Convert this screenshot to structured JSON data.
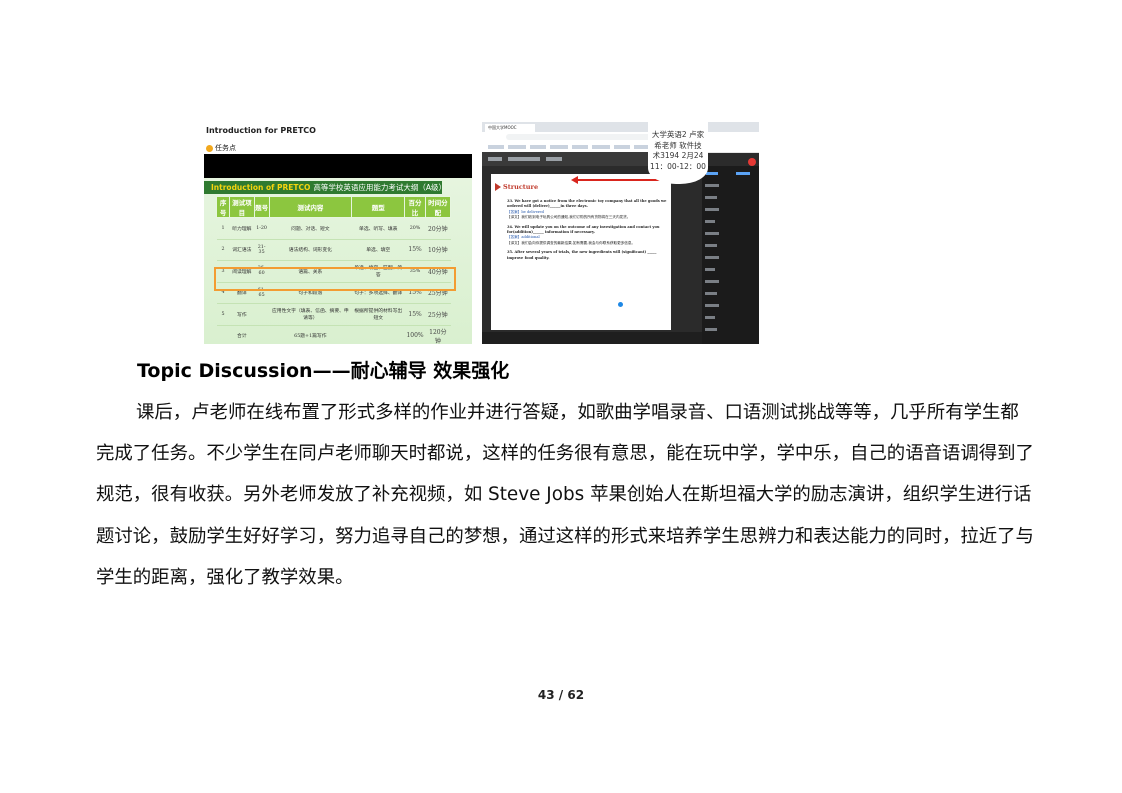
{
  "left_screenshot": {
    "title": "Introduction for PRETCO",
    "task_label": "任务点",
    "banner_highlight": "Introduction of PRETCO",
    "banner_text": "高等学校英语应用能力考试大纲（A级）",
    "table": {
      "headers": [
        "序号",
        "测试项目",
        "题号",
        "测试内容",
        "题型",
        "百分比",
        "时间分配"
      ],
      "rows": [
        [
          "1",
          "听力理解",
          "1-20",
          "问题、对话、短文",
          "单选、听写、填表",
          "20%",
          "20分钟"
        ],
        [
          "2",
          "词汇语法",
          "21-35",
          "语法结构、词形变化",
          "单选、填空",
          "15%",
          "10分钟"
        ],
        [
          "3",
          "阅读理解",
          "36-60",
          "语篇、关系",
          "单选、填空、匹配、简答",
          "35%",
          "40分钟"
        ],
        [
          "4",
          "翻译",
          "61-65",
          "句子和段落",
          "句子：多项选择、翻译",
          "15%",
          "25分钟"
        ],
        [
          "5",
          "写作",
          "",
          "应用性文字（填表、信函、摘要、申请等）",
          "根据所提供的材料写出短文",
          "15%",
          "25分钟"
        ],
        [
          "",
          "合计",
          "",
          "65题+1篇写作",
          "",
          "100%",
          "120分钟"
        ]
      ]
    },
    "play_icon": "play-icon"
  },
  "right_screenshot": {
    "tab_label": "中国大学MOOC",
    "structure_label": "Structure",
    "overlay_lines": [
      "大学英语2 卢家",
      "希老师 软件技",
      "术3194 2月24",
      "11：00-12：00"
    ],
    "questions": [
      {
        "q": "33. We have got a notice from the electronic toy company that all the goods we ordered will (deliver)______in three days.",
        "ans": "【答案】be delivered",
        "exp": "【译文】我们收到电子玩具公司的通知,我们订购的所有货物将在三天内发货。"
      },
      {
        "q": "34. We will update you on the outcome of any investigation and contact you for(addition)______ information if necessary.",
        "ans": "【答案】additional",
        "exp": "【译文】我们会向你提供调查的最新结果,如有需要,我会与你联系获取更多信息。"
      },
      {
        "q": "35. After several years of trials, the new ingredients will (significant) _____ improve food quality.",
        "ans": "",
        "exp": ""
      }
    ]
  },
  "heading": "Topic Discussion——耐心辅导  效果强化",
  "paragraph": "课后，卢老师在线布置了形式多样的作业并进行答疑，如歌曲学唱录音、口语测试挑战等等，几乎所有学生都完成了任务。不少学生在同卢老师聊天时都说，这样的任务很有意思，能在玩中学，学中乐，自己的语音语调得到了规范，很有收获。另外老师发放了补充视频，如 Steve Jobs 苹果创始人在斯坦福大学的励志演讲，组织学生进行话题讨论，鼓励学生好好学习，努力追寻自己的梦想，通过这样的形式来培养学生思辨力和表达能力的同时，拉近了与学生的距离，强化了教学效果。",
  "page_number": "43 / 62"
}
